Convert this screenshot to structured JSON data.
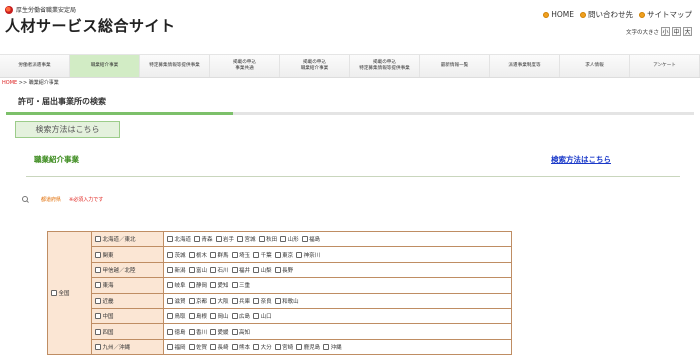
{
  "header": {
    "org": "厚生労働省職業安定局",
    "title": "人材サービス総合サイト",
    "links": [
      "HOME",
      "問い合わせ先",
      "サイトマップ"
    ],
    "font_size_label": "文字の大きさ",
    "font_sizes": [
      "小",
      "中",
      "大"
    ]
  },
  "nav": {
    "items": [
      "労働者派遣事業",
      "職業紹介事業",
      "特定募集情報等提供事業",
      "掲載の申込\n事業共通",
      "掲載の申込\n職業紹介事業",
      "掲載の申込\n特定募集情報等提供事業",
      "最新情報一覧",
      "派遣事業制度等",
      "求人情報",
      "アンケート"
    ],
    "active_index": 1
  },
  "breadcrumb": {
    "home": "HOME",
    "sep": ">>",
    "current": "職業紹介事業"
  },
  "page_title": "許可・届出事業所の検索",
  "howto_button": "検索方法はこちら",
  "section": {
    "title": "職業紹介事業",
    "link": "検索方法はこちら"
  },
  "prefecture": {
    "label": "都道府県",
    "required": "※必須入力です"
  },
  "table": {
    "all_label": "全国",
    "regions": [
      {
        "name": "北海道／東北",
        "prefs": [
          "北海道",
          "青森",
          "岩手",
          "宮城",
          "秋田",
          "山形",
          "福島"
        ]
      },
      {
        "name": "関東",
        "prefs": [
          "茨城",
          "栃木",
          "群馬",
          "埼玉",
          "千葉",
          "東京",
          "神奈川"
        ]
      },
      {
        "name": "甲信越／北陸",
        "prefs": [
          "新潟",
          "富山",
          "石川",
          "福井",
          "山梨",
          "長野"
        ]
      },
      {
        "name": "東海",
        "prefs": [
          "岐阜",
          "静岡",
          "愛知",
          "三重"
        ]
      },
      {
        "name": "近畿",
        "prefs": [
          "滋賀",
          "京都",
          "大阪",
          "兵庫",
          "奈良",
          "和歌山"
        ]
      },
      {
        "name": "中国",
        "prefs": [
          "鳥取",
          "島根",
          "岡山",
          "広島",
          "山口"
        ]
      },
      {
        "name": "四国",
        "prefs": [
          "徳島",
          "香川",
          "愛媛",
          "高知"
        ]
      },
      {
        "name": "九州／沖縄",
        "prefs": [
          "福岡",
          "佐賀",
          "長崎",
          "熊本",
          "大分",
          "宮崎",
          "鹿児島",
          "沖縄"
        ]
      }
    ]
  }
}
